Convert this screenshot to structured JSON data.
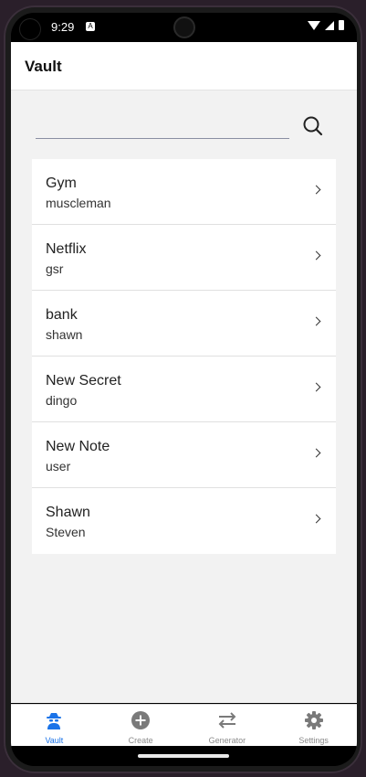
{
  "status_bar": {
    "time": "9:29",
    "notif_icon": "a-notification-icon"
  },
  "app_bar": {
    "title": "Vault"
  },
  "search": {
    "value": "",
    "placeholder": "",
    "icon": "search-icon"
  },
  "items": [
    {
      "title": "Gym",
      "subtitle": "muscleman"
    },
    {
      "title": "Netflix",
      "subtitle": "gsr"
    },
    {
      "title": "bank",
      "subtitle": "shawn"
    },
    {
      "title": "New Secret",
      "subtitle": "dingo"
    },
    {
      "title": "New Note",
      "subtitle": "user"
    },
    {
      "title": "Shawn",
      "subtitle": "Steven"
    }
  ],
  "bottom_nav": {
    "active": "Vault",
    "accent_color": "#1a73e8",
    "inactive_color": "#8a8a8a",
    "items": [
      {
        "label": "Vault",
        "icon": "spy-icon"
      },
      {
        "label": "Create",
        "icon": "plus-circle-icon"
      },
      {
        "label": "Generator",
        "icon": "swap-arrows-icon"
      },
      {
        "label": "Settings",
        "icon": "gear-icon"
      }
    ]
  }
}
